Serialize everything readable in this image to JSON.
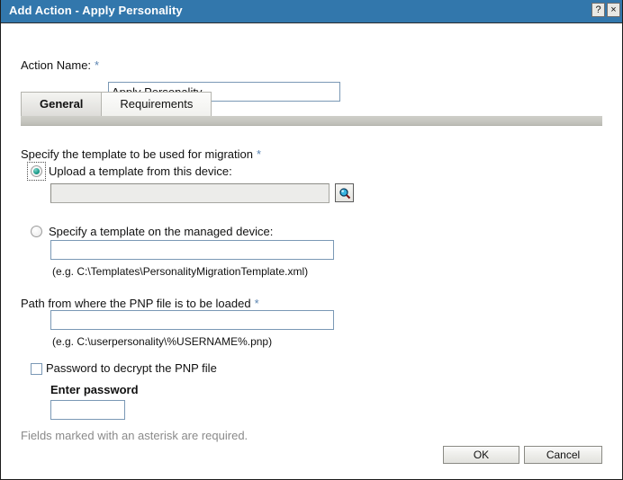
{
  "window": {
    "title": "Add Action - Apply Personality",
    "help_button": "?",
    "close_button": "×",
    "titlebar_color": "#3277ac"
  },
  "form": {
    "action_name_label": "Action Name:",
    "action_name_value": "Apply Personality",
    "required_marker": "*"
  },
  "tabs": [
    {
      "label": "General",
      "selected": true
    },
    {
      "label": "Requirements",
      "selected": false
    }
  ],
  "general": {
    "template_section_label": "Specify the template to be used for migration",
    "upload_radio_label": "Upload a template from this device:",
    "upload_input_value": "",
    "browse_icon": "magnifier-icon",
    "managed_radio_label": "Specify a template on the managed device:",
    "managed_input_value": "",
    "managed_hint": "(e.g. C:\\Templates\\PersonalityMigrationTemplate.xml)",
    "pnp_path_label": "Path from where the PNP file is to be loaded",
    "pnp_path_value": "",
    "pnp_hint": "(e.g. C:\\userpersonality\\%USERNAME%.pnp)",
    "password_checkbox_label": "Password to decrypt the PNP file",
    "password_field_label": "Enter password",
    "password_value": ""
  },
  "footer": {
    "required_note": "Fields marked with an asterisk are required.",
    "ok_label": "OK",
    "cancel_label": "Cancel"
  }
}
